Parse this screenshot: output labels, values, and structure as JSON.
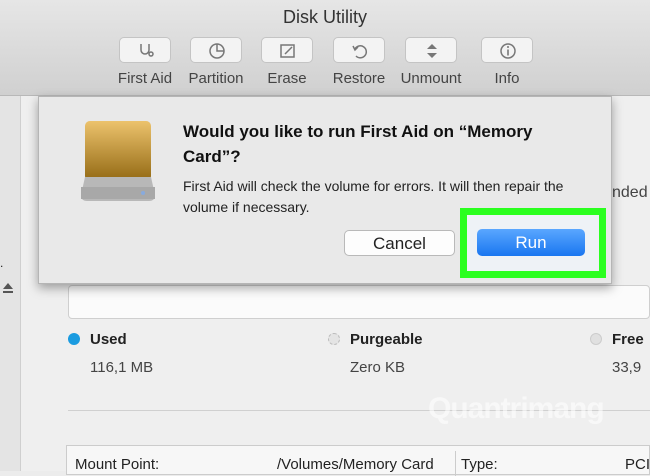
{
  "window": {
    "title": "Disk Utility"
  },
  "toolbar": {
    "buttons": [
      {
        "label": "First Aid",
        "icon": "stethoscope-icon"
      },
      {
        "label": "Partition",
        "icon": "pie-chart-icon"
      },
      {
        "label": "Erase",
        "icon": "pencil-icon"
      },
      {
        "label": "Restore",
        "icon": "restore-icon"
      },
      {
        "label": "Unmount",
        "icon": "unmount-icon"
      },
      {
        "label": "Info",
        "icon": "info-icon"
      }
    ]
  },
  "background": {
    "partial_text": "nded",
    "legend": [
      {
        "label": "Used",
        "value": "116,1 MB",
        "color": "#1a9be0"
      },
      {
        "label": "Purgeable",
        "value": "Zero KB",
        "color": "#cfcfcf"
      },
      {
        "label": "Free",
        "value": "33,9",
        "color": "#e0e0e0"
      }
    ],
    "info_row": {
      "mount_point_label": "Mount Point:",
      "mount_point_value": "/Volumes/Memory Card",
      "type_label": "Type:",
      "type_value": "PCI"
    }
  },
  "dialog": {
    "title": "Would you like to run First Aid on “Memory Card”?",
    "message": "First Aid will check the volume for errors. It will then repair the volume if necessary.",
    "cancel_label": "Cancel",
    "run_label": "Run",
    "highlight_color": "#2bff1f",
    "accent_color": "#1976f0"
  },
  "watermark": "Quantrimang"
}
